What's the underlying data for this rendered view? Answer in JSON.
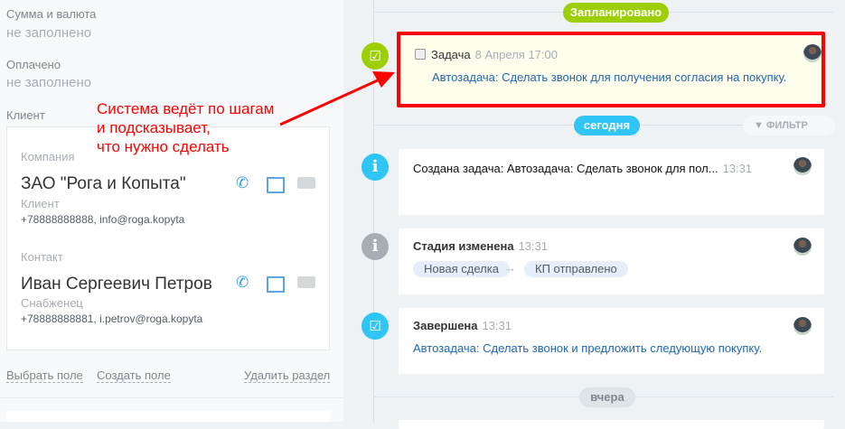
{
  "left": {
    "fields": [
      {
        "label": "Сумма и валюта",
        "value": "не заполнено"
      },
      {
        "label": "Оплачено",
        "value": "не заполнено"
      }
    ],
    "client_label": "Клиент",
    "company": {
      "label": "Компания",
      "name": "ЗАО \"Рога и Копыта\"",
      "role": "Клиент",
      "contacts": "+78888888888, info@roga.kopyta"
    },
    "contact": {
      "label": "Контакт",
      "name": "Иван Сергеевич Петров",
      "role": "Снабженец",
      "contacts": "+78888888881, i.petrov@roga.kopyta"
    },
    "links": {
      "select": "Выбрать поле",
      "create": "Создать поле",
      "delete": "Удалить раздел"
    }
  },
  "annotation": [
    "Система ведёт по шагам",
    "и подсказывает,",
    "что нужно сделать"
  ],
  "timeline": {
    "planned": "Запланировано",
    "today": "сегодня",
    "yesterday": "вчера",
    "filter": "ФИЛЬТР",
    "task": {
      "title": "Задача",
      "date": "8 Апреля 17:00",
      "text": "Автозадача: Сделать звонок для получения согласия на покупку."
    },
    "created": {
      "title": "Создана задача: Автозадача: Сделать звонок для пол...",
      "time": "13:31"
    },
    "stage": {
      "title": "Стадия изменена",
      "time": "13:31",
      "from": "Новая сделка",
      "arrow": "→",
      "to": "КП отправлено"
    },
    "done": {
      "title": "Завершена",
      "time": "13:31",
      "text": "Автозадача: Сделать звонок и предложить следующую покупку."
    }
  },
  "colors": {
    "planned": "#9dcf00",
    "today": "#2fc6f6",
    "highlight": "#ff0000"
  }
}
